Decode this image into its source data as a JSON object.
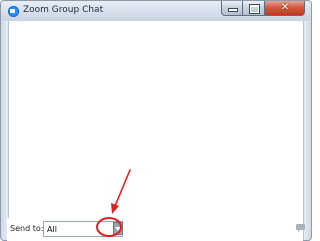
{
  "window": {
    "title": "Zoom Group Chat",
    "app_icon": "zoom-icon",
    "controls": {
      "minimize_icon": "minimize-icon",
      "maximize_icon": "maximize-icon",
      "close_icon": "close-icon",
      "close_glyph": "✕"
    }
  },
  "footer": {
    "send_to_label": "Send to:",
    "send_to_value": "All",
    "dropdown_icon": "chevron-down-icon",
    "chat_icon": "chat-bubble-icon"
  },
  "annotation": {
    "color": "#e02020",
    "arrow_icon": "red-arrow-icon",
    "circle_icon": "red-circle-highlight"
  },
  "colors": {
    "title_bar": "#d6dfea",
    "close_button": "#c23a1e",
    "zoom_blue": "#2d8cff"
  }
}
